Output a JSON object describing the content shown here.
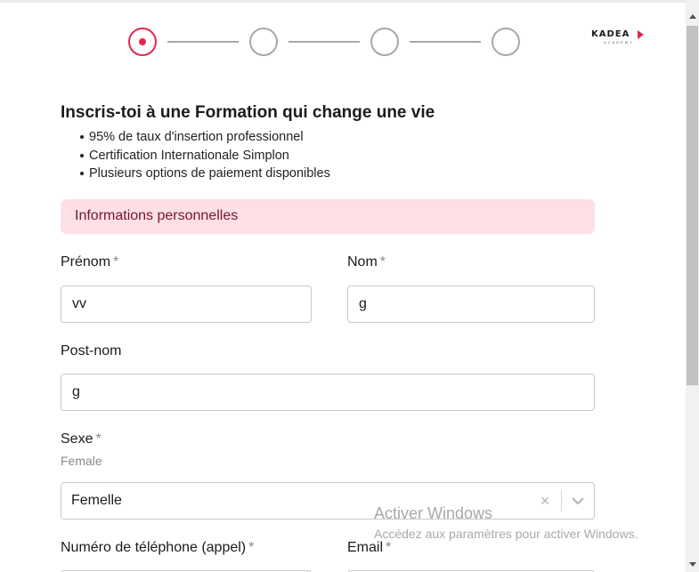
{
  "stepper": {
    "steps": [
      {
        "state": "active"
      },
      {
        "state": "inactive"
      },
      {
        "state": "inactive"
      },
      {
        "state": "inactive"
      }
    ],
    "active_color": "#e0284f"
  },
  "logo": {
    "text": "KADEA",
    "sub": "ACADEMY",
    "icon": "play-arrow-icon"
  },
  "heading": {
    "title": "Inscris-toi à une Formation qui change une vie",
    "bullets": [
      "95% de taux d'insertion professionnel",
      "Certification Internationale Simplon",
      "Plusieurs options de paiement disponibles"
    ]
  },
  "section": {
    "title": "Informations personnelles"
  },
  "form": {
    "prenom": {
      "label": "Prénom",
      "required": "*",
      "value": "vv"
    },
    "nom": {
      "label": "Nom",
      "required": "*",
      "value": "g"
    },
    "postnom": {
      "label": "Post-nom",
      "value": "g"
    },
    "sexe": {
      "label": "Sexe",
      "required": "*",
      "hint": "Female",
      "value": "Femelle",
      "clear_icon": "close-icon",
      "dropdown_icon": "chevron-down-icon"
    },
    "telephone": {
      "label": "Numéro de téléphone (appel)",
      "required": "*"
    },
    "email": {
      "label": "Email",
      "required": "*"
    }
  },
  "watermark": {
    "line1": "Activer Windows",
    "line2": "Accédez aux paramètres pour activer Windows."
  },
  "colors": {
    "accent": "#e0284f",
    "banner_bg": "#fce0e6",
    "banner_text": "#7a1233"
  }
}
